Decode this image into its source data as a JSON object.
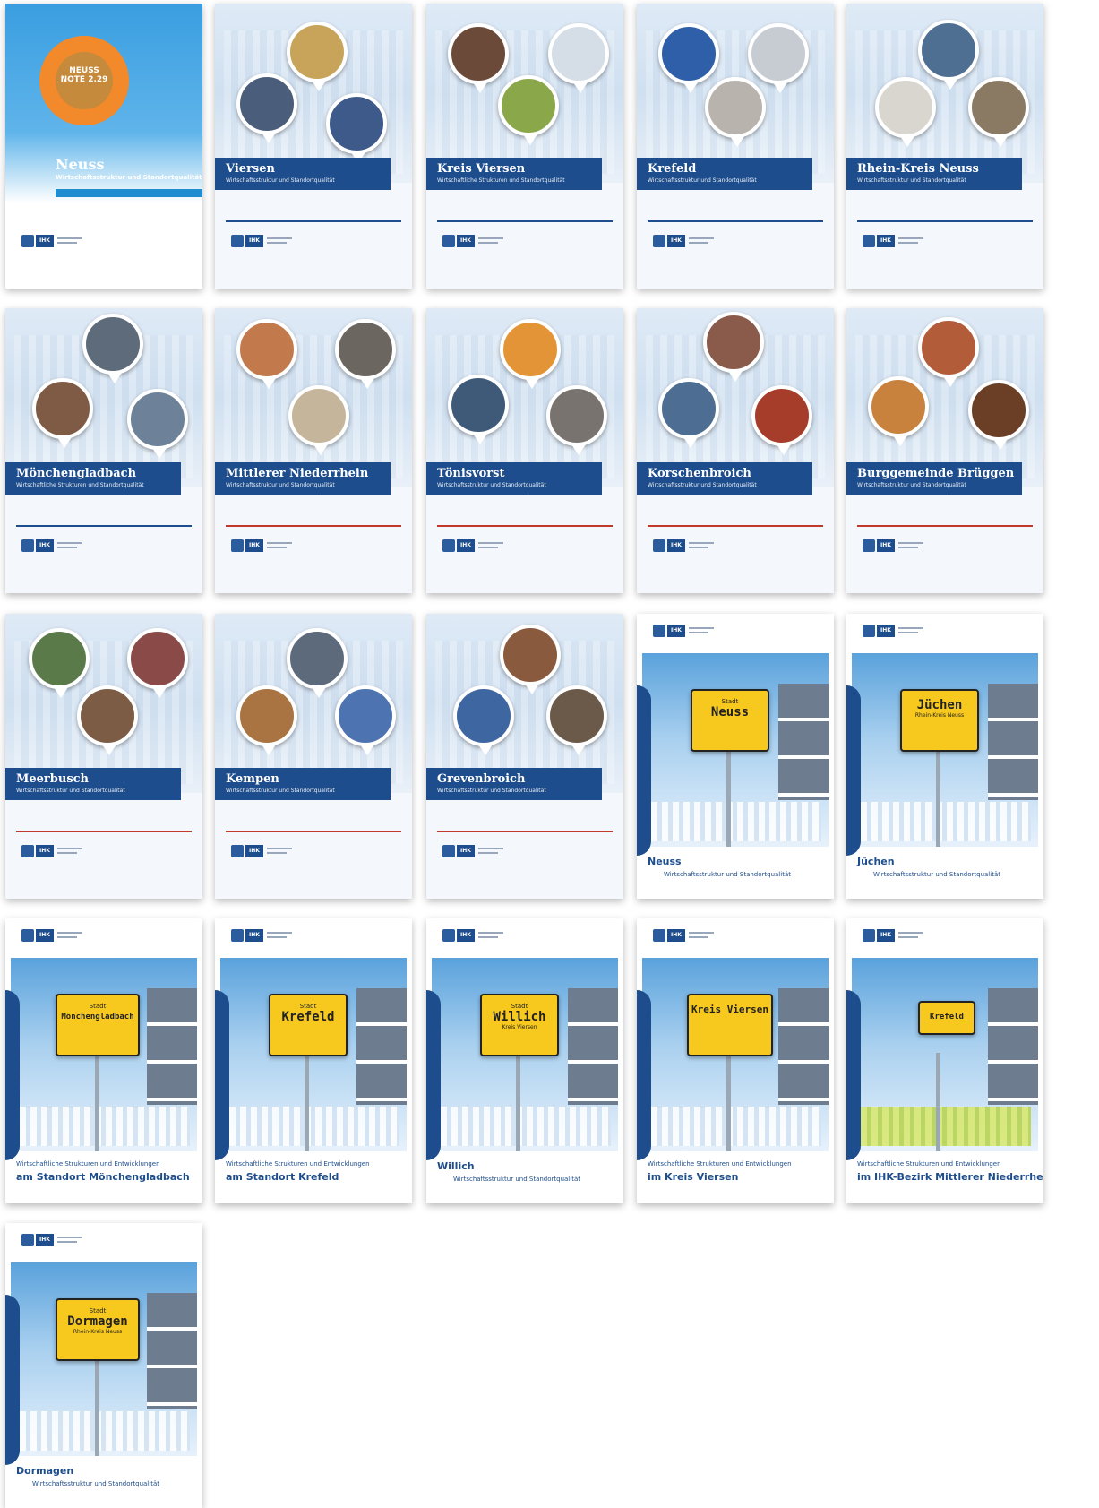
{
  "covers": [
    {
      "title": "Neuss",
      "subtitle": "Wirtschaftsstruktur und Standortqualität",
      "badge": "NEUSS NOTE 2.29"
    },
    {
      "title": "Viersen",
      "subtitle": "Wirtschaftsstruktur und Standortqualität"
    },
    {
      "title": "Kreis Viersen",
      "subtitle": "Wirtschaftliche Strukturen und Standortqualität"
    },
    {
      "title": "Krefeld",
      "subtitle": "Wirtschaftsstruktur und Standortqualität"
    },
    {
      "title": "Rhein-Kreis Neuss",
      "subtitle": "Wirtschaftsstruktur und Standortqualität"
    },
    {
      "title": "Mönchengladbach",
      "subtitle": "Wirtschaftliche Strukturen und Standortqualität"
    },
    {
      "title": "Mittlerer Niederrhein",
      "subtitle": "Wirtschaftsstruktur und Standortqualität"
    },
    {
      "title": "Tönisvorst",
      "subtitle": "Wirtschaftsstruktur und Standortqualität"
    },
    {
      "title": "Korschenbroich",
      "subtitle": "Wirtschaftsstruktur und Standortqualität"
    },
    {
      "title": "Burggemeinde Brüggen",
      "subtitle": "Wirtschaftsstruktur und Standortqualität"
    },
    {
      "title": "Meerbusch",
      "subtitle": "Wirtschaftsstruktur und Standortqualität"
    },
    {
      "title": "Kempen",
      "subtitle": "Wirtschaftsstruktur und Standortqualität"
    },
    {
      "title": "Grevenbroich",
      "subtitle": "Wirtschaftsstruktur und Standortqualität"
    }
  ],
  "sign_covers": [
    {
      "sign_top": "Stadt",
      "sign_name": "Neuss",
      "sign_region": "",
      "title": "Neuss",
      "subtitle": "Wirtschaftsstruktur und Standortqualität"
    },
    {
      "sign_top": "",
      "sign_name": "Jüchen",
      "sign_region": "Rhein-Kreis Neuss",
      "title": "Jüchen",
      "subtitle": "Wirtschaftsstruktur und Standortqualität"
    },
    {
      "sign_top": "Stadt",
      "sign_name": "Mönchengladbach",
      "sign_region": "",
      "title_a": "Wirtschaftliche Strukturen und Entwicklungen",
      "title_b": "am Standort Mönchengladbach"
    },
    {
      "sign_top": "Stadt",
      "sign_name": "Krefeld",
      "sign_region": "",
      "title_a": "Wirtschaftliche Strukturen und Entwicklungen",
      "title_b": "am Standort Krefeld"
    },
    {
      "sign_top": "Stadt",
      "sign_name": "Willich",
      "sign_region": "Kreis Viersen",
      "title": "Willich",
      "subtitle": "Wirtschaftsstruktur und Standortqualität"
    },
    {
      "sign_top": "",
      "sign_name": "Kreis Viersen",
      "sign_region": "",
      "title_a": "Wirtschaftliche Strukturen und Entwicklungen",
      "title_b": "im Kreis Viersen"
    },
    {
      "sign_top": "",
      "sign_name": "Krefeld",
      "sign_region": "",
      "title_a": "Wirtschaftliche Strukturen und Entwicklungen",
      "title_b": "im IHK-Bezirk Mittlerer Niederrhein"
    },
    {
      "sign_top": "Stadt",
      "sign_name": "Dormagen",
      "sign_region": "Rhein-Kreis Neuss",
      "title": "Dormagen",
      "subtitle": "Wirtschaftsstruktur und Standortqualität"
    }
  ],
  "logo_text": "IHK"
}
